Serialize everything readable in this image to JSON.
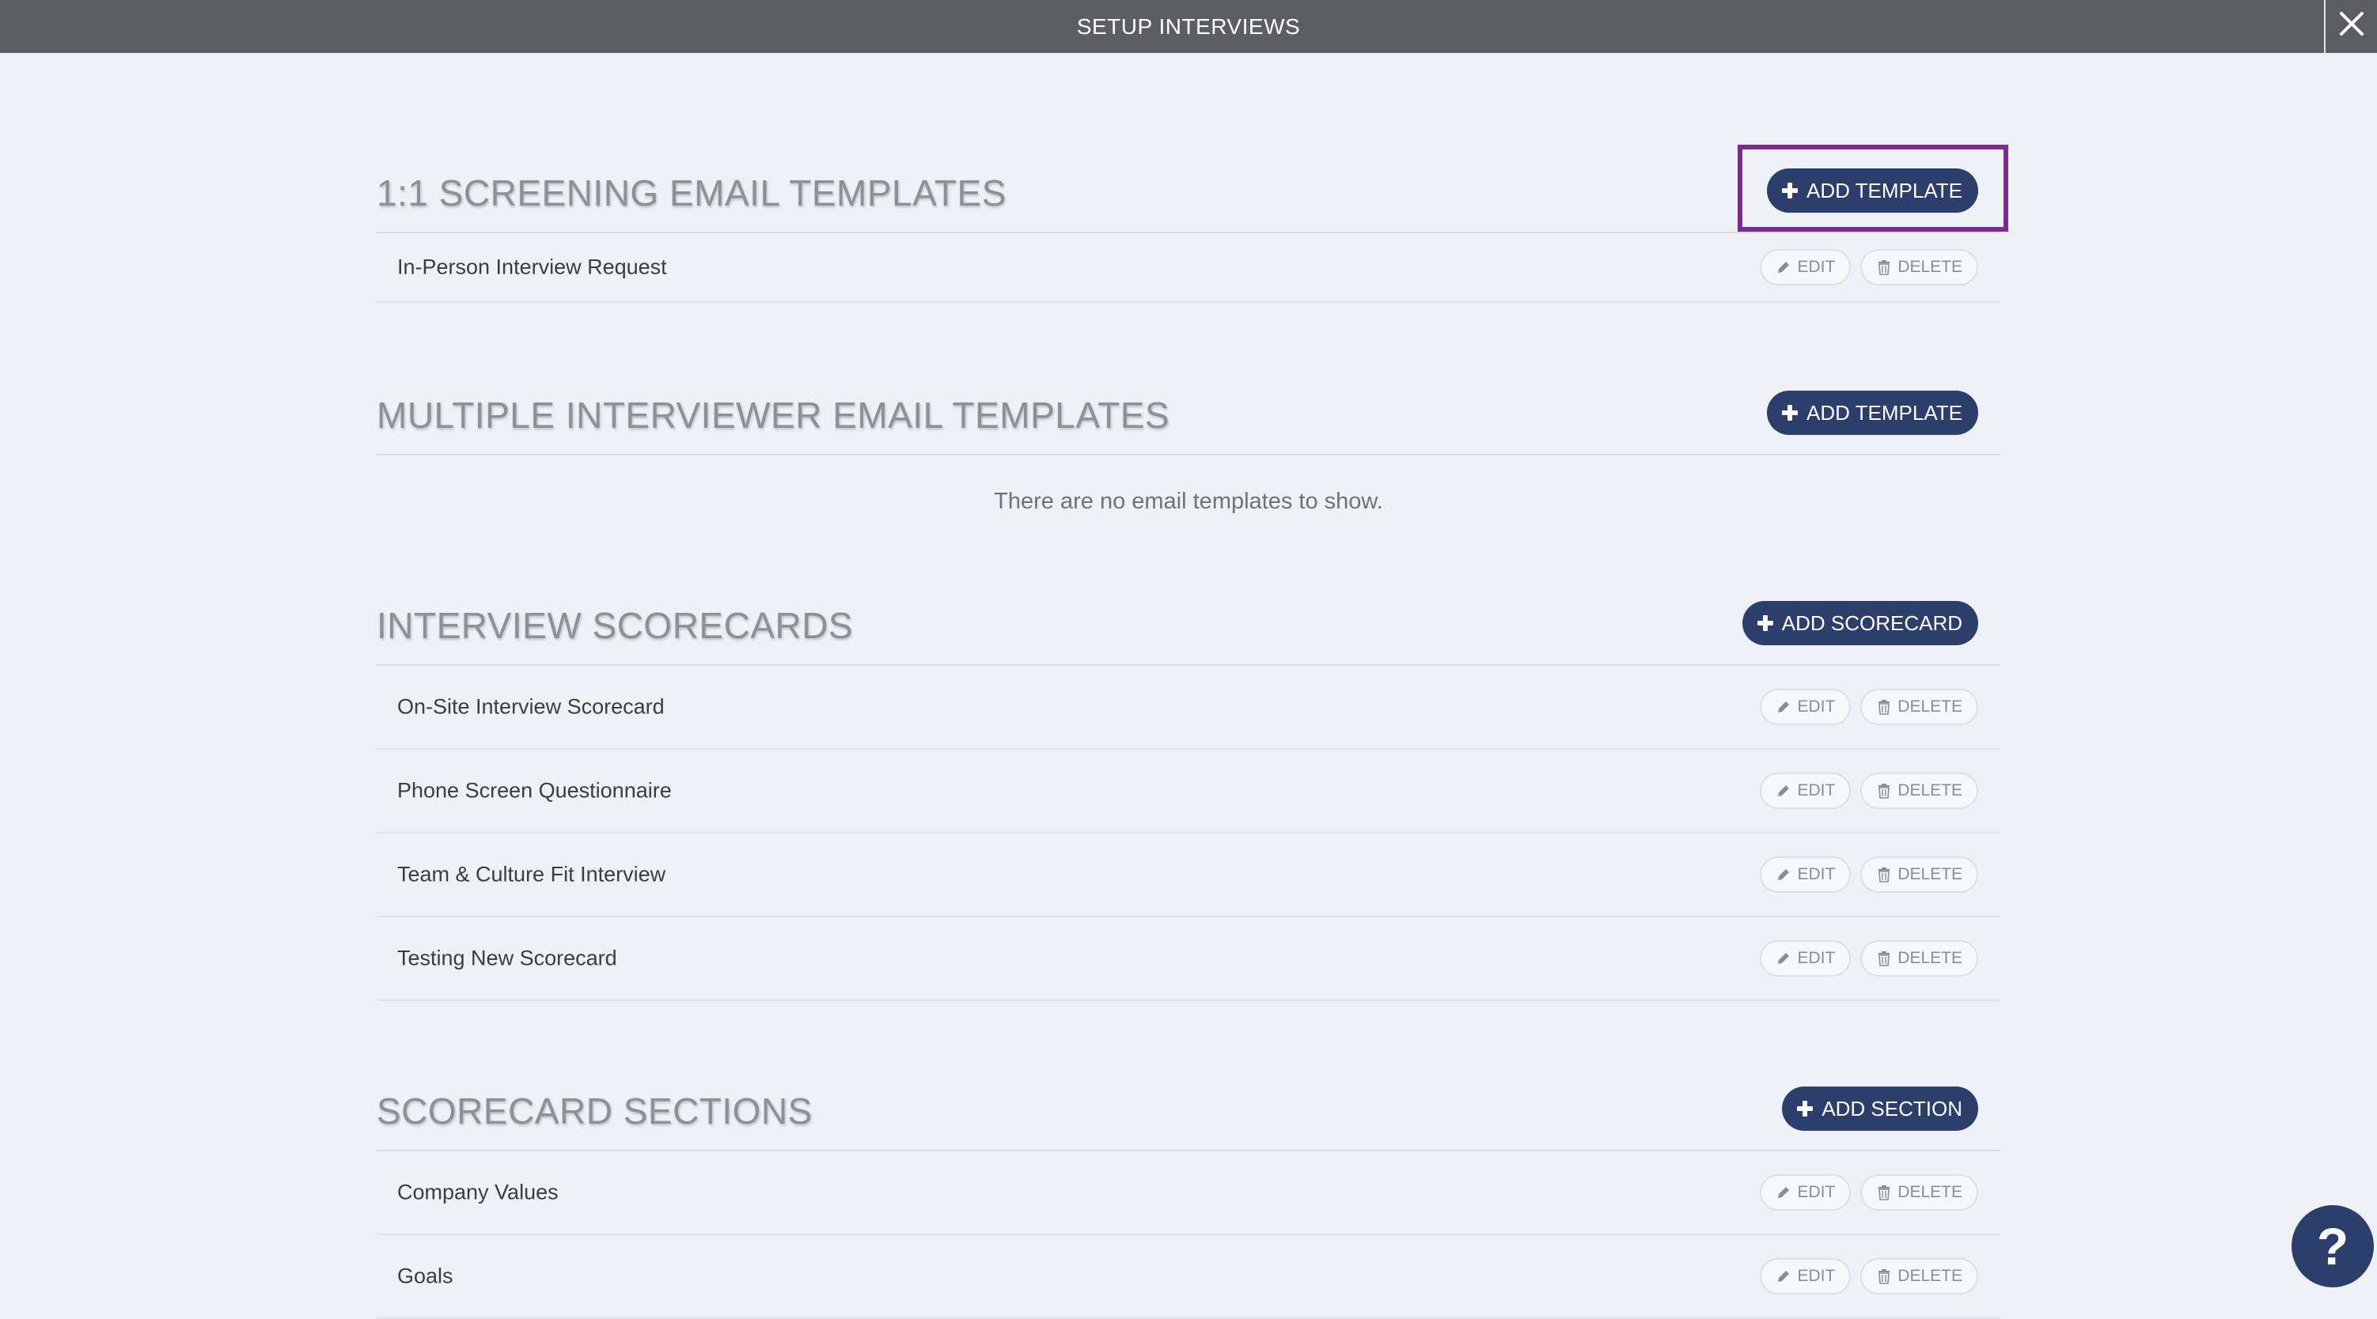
{
  "window": {
    "title": "SETUP INTERVIEWS",
    "close_icon": "close-icon"
  },
  "sections": [
    {
      "title": "1:1 SCREENING EMAIL TEMPLATES",
      "add_label": "ADD TEMPLATE",
      "rows": [
        {
          "label": "In-Person Interview Request"
        }
      ]
    },
    {
      "title": "MULTIPLE INTERVIEWER EMAIL TEMPLATES",
      "add_label": "ADD TEMPLATE",
      "empty_message": "There are no email templates to show."
    },
    {
      "title": "INTERVIEW SCORECARDS",
      "add_label": "ADD SCORECARD",
      "rows": [
        {
          "label": "On-Site Interview Scorecard"
        },
        {
          "label": "Phone Screen Questionnaire"
        },
        {
          "label": "Team & Culture Fit Interview"
        },
        {
          "label": "Testing New Scorecard"
        }
      ]
    },
    {
      "title": "SCORECARD SECTIONS",
      "add_label": "ADD SECTION",
      "rows": [
        {
          "label": "Company Values"
        },
        {
          "label": "Goals"
        }
      ]
    }
  ],
  "actions": {
    "edit_label": "EDIT",
    "delete_label": "DELETE"
  },
  "help": {
    "label": "?"
  },
  "colors": {
    "topbar": "#5c5e61",
    "background": "#eef1f5",
    "primary_button": "#2c3e6b",
    "highlight": "#7b2a8f"
  }
}
